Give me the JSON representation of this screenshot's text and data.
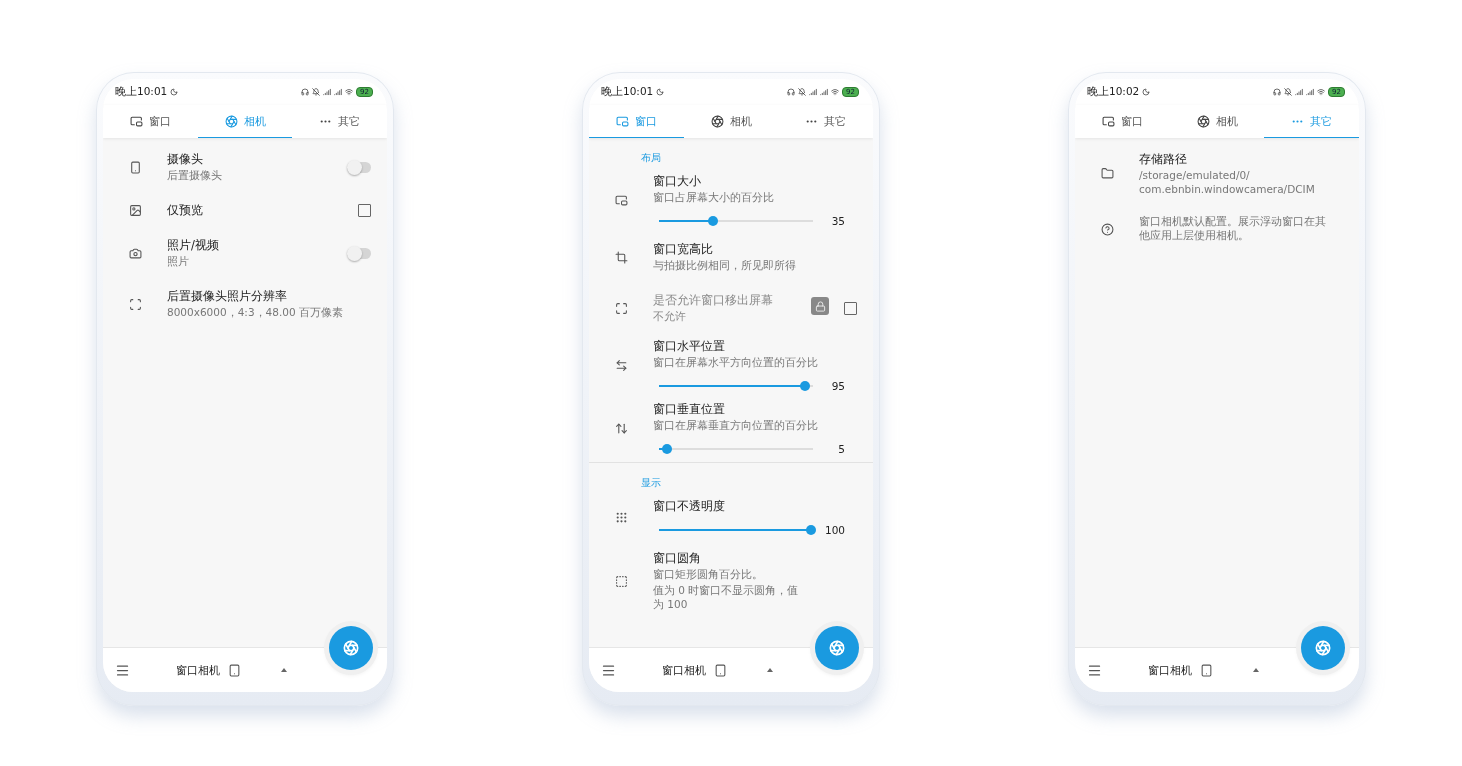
{
  "phones": [
    {
      "status": {
        "time": "晚上10:01",
        "battery": "92"
      },
      "tabs": [
        {
          "label": "窗口",
          "selected": false
        },
        {
          "label": "相机",
          "selected": true
        },
        {
          "label": "其它",
          "selected": false
        }
      ],
      "sections": [
        {
          "items": [
            {
              "kind": "switch",
              "title": "摄像头",
              "subtitle": "后置摄像头",
              "on": false
            },
            {
              "kind": "checkbox",
              "title": "仅预览",
              "checked": false,
              "disabled": false
            },
            {
              "kind": "switch",
              "title": "照片/视频",
              "subtitle": "照片",
              "on": false
            },
            {
              "kind": "text",
              "title": "后置摄像头照片分辨率",
              "subtitle": "8000x6000，4:3，48.00 百万像素"
            }
          ]
        }
      ],
      "bottom_bar": {
        "title": "窗口相机"
      }
    },
    {
      "status": {
        "time": "晚上10:01",
        "battery": "92"
      },
      "tabs": [
        {
          "label": "窗口",
          "selected": true
        },
        {
          "label": "相机",
          "selected": false
        },
        {
          "label": "其它",
          "selected": false
        }
      ],
      "sections": [
        {
          "header": "布局",
          "items": [
            {
              "kind": "slider",
              "title": "窗口大小",
              "subtitle": "窗口占屏幕大小的百分比",
              "level": 0.35,
              "reading": "35"
            },
            {
              "kind": "text",
              "title": "窗口宽高比",
              "subtitle": "与拍摄比例相同，所见即所得"
            },
            {
              "kind": "checkbox",
              "title": "是否允许窗口移出屏幕",
              "subtitle": "不允许",
              "checked": false,
              "disabled": true
            },
            {
              "kind": "slider",
              "title": "窗口水平位置",
              "subtitle": "窗口在屏幕水平方向位置的百分比",
              "level": 0.95,
              "reading": "95"
            },
            {
              "kind": "slider",
              "title": "窗口垂直位置",
              "subtitle": "窗口在屏幕垂直方向位置的百分比",
              "level": 0.05,
              "reading": "5"
            }
          ]
        },
        {
          "header": "显示",
          "items": [
            {
              "kind": "slider",
              "title": "窗口不透明度",
              "level": 1,
              "reading": "100"
            },
            {
              "kind": "text",
              "title": "窗口圆角",
              "subtitle": "窗口矩形圆角百分比。",
              "subtitle2": "值为 0 时窗口不显示圆角，值为 100"
            }
          ]
        }
      ],
      "bottom_bar": {
        "title": "窗口相机"
      }
    },
    {
      "status": {
        "time": "晚上10:02",
        "battery": "92"
      },
      "tabs": [
        {
          "label": "窗口",
          "selected": false
        },
        {
          "label": "相机",
          "selected": false
        },
        {
          "label": "其它",
          "selected": true
        }
      ],
      "sections": [
        {
          "items": [
            {
              "kind": "text",
              "title": "存储路径",
              "subtitle": "/storage/emulated/0/",
              "subtitle2": "com.ebnbin.windowcamera/DCIM"
            },
            {
              "kind": "text",
              "subtitle": "窗口相机默认配置。展示浮动窗口在其他应用上层使用相机。"
            }
          ]
        }
      ],
      "bottom_bar": {
        "title": "窗口相机"
      }
    }
  ]
}
